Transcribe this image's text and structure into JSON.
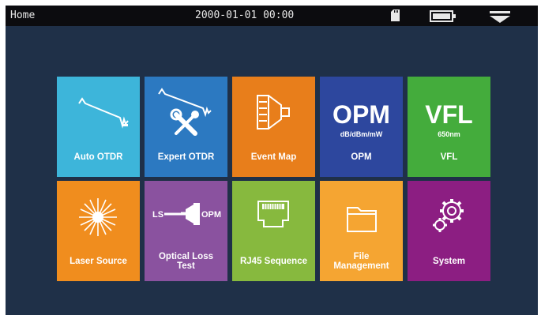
{
  "status_bar": {
    "title": "Home",
    "datetime": "2000-01-01 00:00",
    "sd_icon": "sd-card-icon",
    "battery_icon": "battery-icon",
    "menu_icon": "dropdown-menu-icon"
  },
  "tiles": [
    {
      "label": "Auto OTDR",
      "color": "#3db5da",
      "icon": "otdr-trace-icon"
    },
    {
      "label": "Expert OTDR",
      "color": "#2c79c1",
      "icon": "otdr-tools-icon"
    },
    {
      "label": "Event Map",
      "color": "#e87e1b",
      "icon": "connector-icon"
    },
    {
      "label": "OPM",
      "big": "OPM",
      "sub": "dB/dBm/mW",
      "color": "#2d479e",
      "icon": "opm-text-icon"
    },
    {
      "label": "VFL",
      "big": "VFL",
      "sub": "650nm",
      "color": "#44ac3c",
      "icon": "vfl-text-icon"
    },
    {
      "label": "Laser Source",
      "color": "#f08d1e",
      "icon": "laser-burst-icon"
    },
    {
      "label_line1": "Optical Loss",
      "label_line2": "Test",
      "color": "#8a529f",
      "icon": "ls-opm-icon",
      "ls_text": "LS",
      "opm_text": "OPM"
    },
    {
      "label": "RJ45 Sequence",
      "color": "#87b93e",
      "icon": "rj45-icon"
    },
    {
      "label_line1": "File",
      "label_line2": "Management",
      "color": "#f5a532",
      "icon": "folder-icon"
    },
    {
      "label": "System",
      "color": "#8c1e82",
      "icon": "gear-icon"
    }
  ]
}
